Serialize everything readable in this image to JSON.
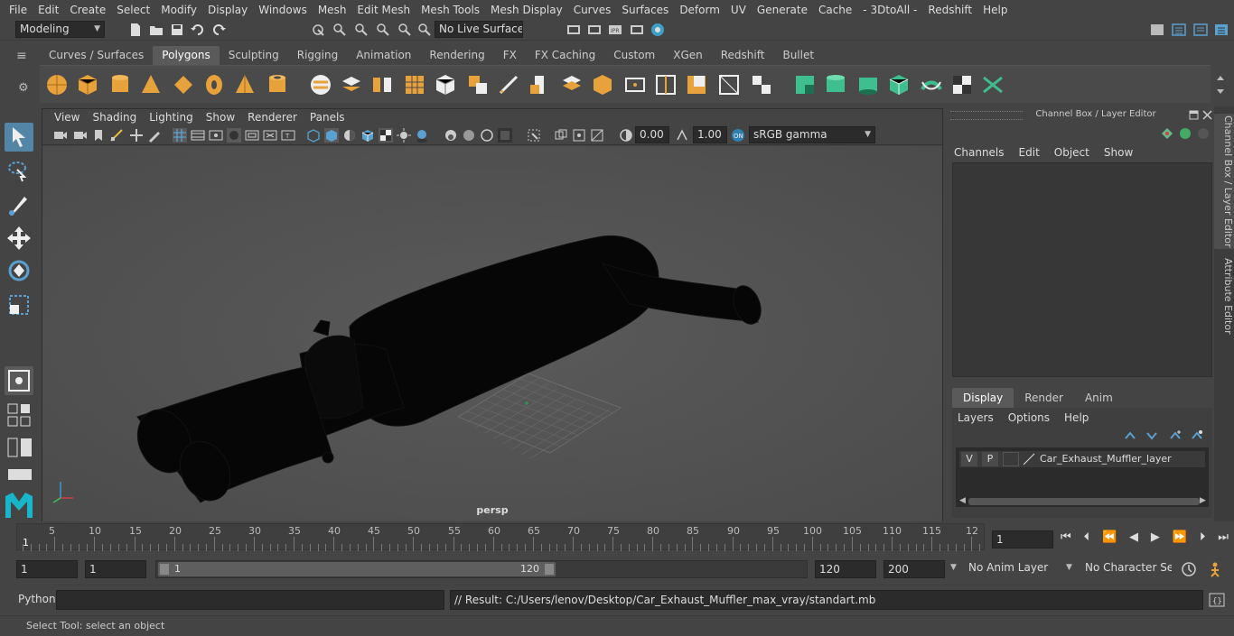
{
  "menubar": {
    "items": [
      "File",
      "Edit",
      "Create",
      "Select",
      "Modify",
      "Display",
      "Windows",
      "Mesh",
      "Edit Mesh",
      "Mesh Tools",
      "Mesh Display",
      "Curves",
      "Surfaces",
      "Deform",
      "UV",
      "Generate",
      "Cache",
      "- 3DtoAll -",
      "Redshift",
      "Help"
    ]
  },
  "statusline": {
    "mode": "Modeling",
    "live_surface": "No Live Surface"
  },
  "shelf": {
    "tabs": [
      "Curves / Surfaces",
      "Polygons",
      "Sculpting",
      "Rigging",
      "Animation",
      "Rendering",
      "FX",
      "FX Caching",
      "Custom",
      "XGen",
      "Redshift",
      "Bullet"
    ],
    "active_tab": "Polygons"
  },
  "viewport": {
    "menu": [
      "View",
      "Shading",
      "Lighting",
      "Show",
      "Renderer",
      "Panels"
    ],
    "exposure": "0.00",
    "gamma": "1.00",
    "color_space": "sRGB gamma",
    "camera": "persp"
  },
  "channel_box": {
    "title": "Channel Box / Layer Editor",
    "menu": [
      "Channels",
      "Edit",
      "Object",
      "Show"
    ]
  },
  "layer_editor": {
    "tabs": [
      "Display",
      "Render",
      "Anim"
    ],
    "active_tab": "Display",
    "menu": [
      "Layers",
      "Options",
      "Help"
    ],
    "layers": [
      {
        "v": "V",
        "p": "P",
        "name": "Car_Exhaust_Muffler_layer"
      }
    ]
  },
  "side_tabs": [
    "Channel Box / Layer Editor",
    "Attribute Editor"
  ],
  "timeline": {
    "ticks": [
      "5",
      "10",
      "15",
      "20",
      "25",
      "30",
      "35",
      "40",
      "45",
      "50",
      "55",
      "60",
      "65",
      "70",
      "75",
      "80",
      "85",
      "90",
      "95",
      "100",
      "105",
      "110",
      "115",
      "12"
    ],
    "current_frame_marker": "1",
    "current_frame": "1"
  },
  "range": {
    "start": "1",
    "playback_start": "1",
    "slider_start": "1",
    "slider_end": "120",
    "playback_end": "120",
    "end": "200",
    "anim_layer": "No Anim Layer",
    "character_set": "No Character Set"
  },
  "cmdline": {
    "label": "Python",
    "result": "// Result: C:/Users/lenov/Desktop/Car_Exhaust_Muffler_max_vray/standart.mb"
  },
  "helpline": {
    "text": "Select Tool: select an object"
  },
  "colors": {
    "accent": "#5285a6",
    "shelf_orange": "#e8a23c",
    "shelf_green": "#3fbf8f"
  }
}
